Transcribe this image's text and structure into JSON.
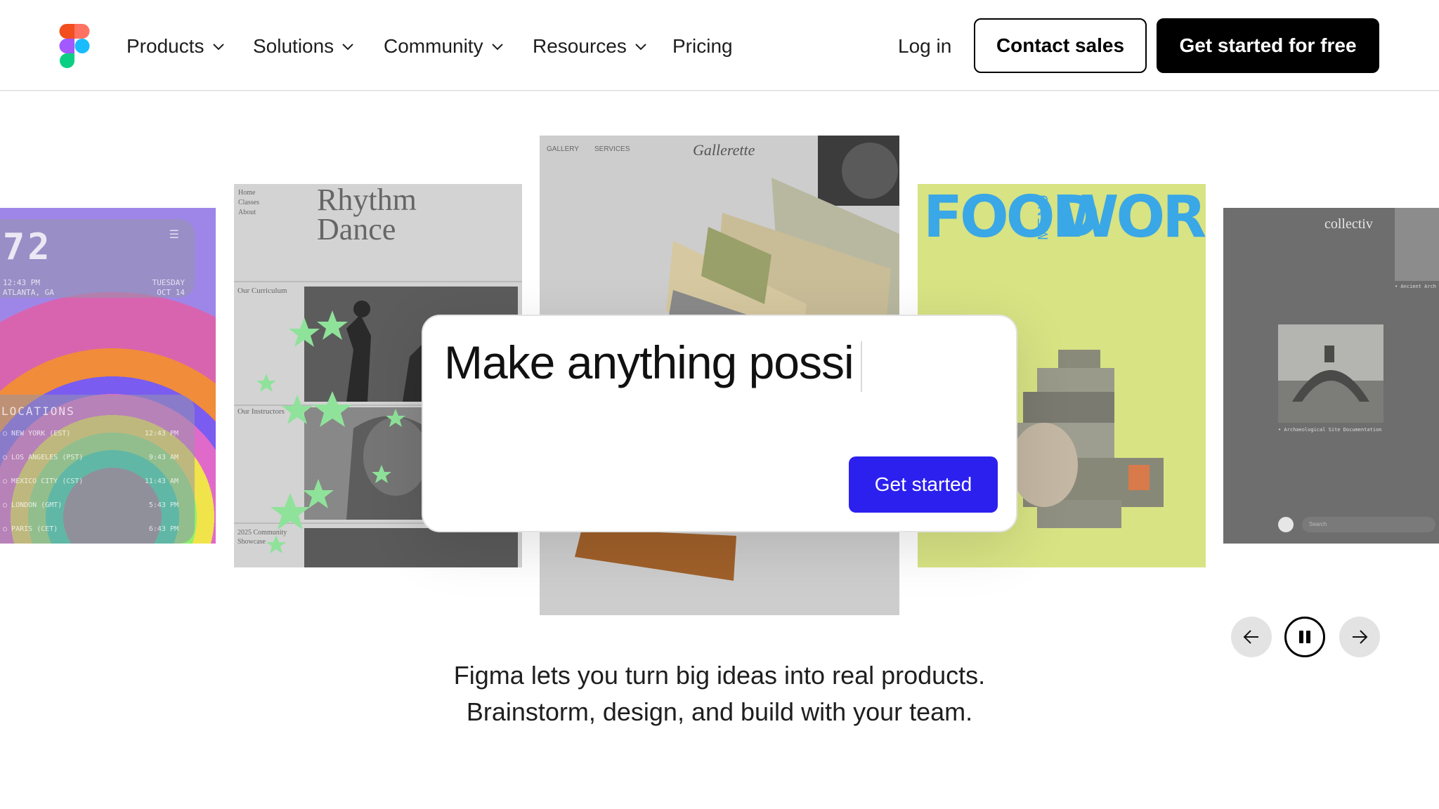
{
  "nav": {
    "items": [
      {
        "label": "Products",
        "has_menu": true
      },
      {
        "label": "Solutions",
        "has_menu": true
      },
      {
        "label": "Community",
        "has_menu": true
      },
      {
        "label": "Resources",
        "has_menu": true
      },
      {
        "label": "Pricing",
        "has_menu": false
      }
    ],
    "login_label": "Log in",
    "contact_label": "Contact sales",
    "cta_label": "Get started for free"
  },
  "carousel": {
    "card1": {
      "clock": "72",
      "time": "12:43 PM",
      "city": "ATLANTA, GA",
      "day": "TUESDAY",
      "date": "OCT 14",
      "locations_title": "LOCATIONS",
      "locations": [
        {
          "name": "NEW YORK",
          "tz": "(EST)",
          "time": "12:43 PM"
        },
        {
          "name": "LOS ANGELES",
          "tz": "(PST)",
          "time": "9:43 AM"
        },
        {
          "name": "MEXICO CITY",
          "tz": "(CST)",
          "time": "11:43 AM"
        },
        {
          "name": "LONDON",
          "tz": "(GMT)",
          "time": "5:43 PM"
        },
        {
          "name": "PARIS",
          "tz": "(CET)",
          "time": "6:43 PM"
        }
      ]
    },
    "card2": {
      "nav_links": [
        "Home",
        "Classes",
        "About"
      ],
      "title_line1": "Rhythm",
      "title_line2": "Dance",
      "section1": "Our Curriculum",
      "section2": "Our Instructors",
      "section3_line1": "2025 Community",
      "section3_line2": "Showcase"
    },
    "card3": {
      "nav1": "GALLERY",
      "nav2": "SERVICES",
      "brand": "Gallerette"
    },
    "card4": {
      "word1": "FOOD",
      "word2": "MENU",
      "word3": "WORKS"
    },
    "card5": {
      "brand": "collectiv",
      "caption1": "• Ancient Arch",
      "caption2": "• Archaeological Site Documentation",
      "input_placeholder": "Search"
    }
  },
  "prompt": {
    "typed_text": "Make anything possi",
    "button_label": "Get started"
  },
  "controls": {
    "prev_icon": "arrow-left-icon",
    "pause_icon": "pause-icon",
    "next_icon": "arrow-right-icon"
  },
  "tagline": {
    "line1": "Figma lets you turn big ideas into real products.",
    "line2": "Brainstorm, design, and build with your team."
  },
  "colors": {
    "primary_blue": "#2c20ef",
    "dark": "#000000",
    "food_works_blue": "#3aa7e6",
    "card4_bg": "#d8e384",
    "star_green": "#7de08a"
  }
}
